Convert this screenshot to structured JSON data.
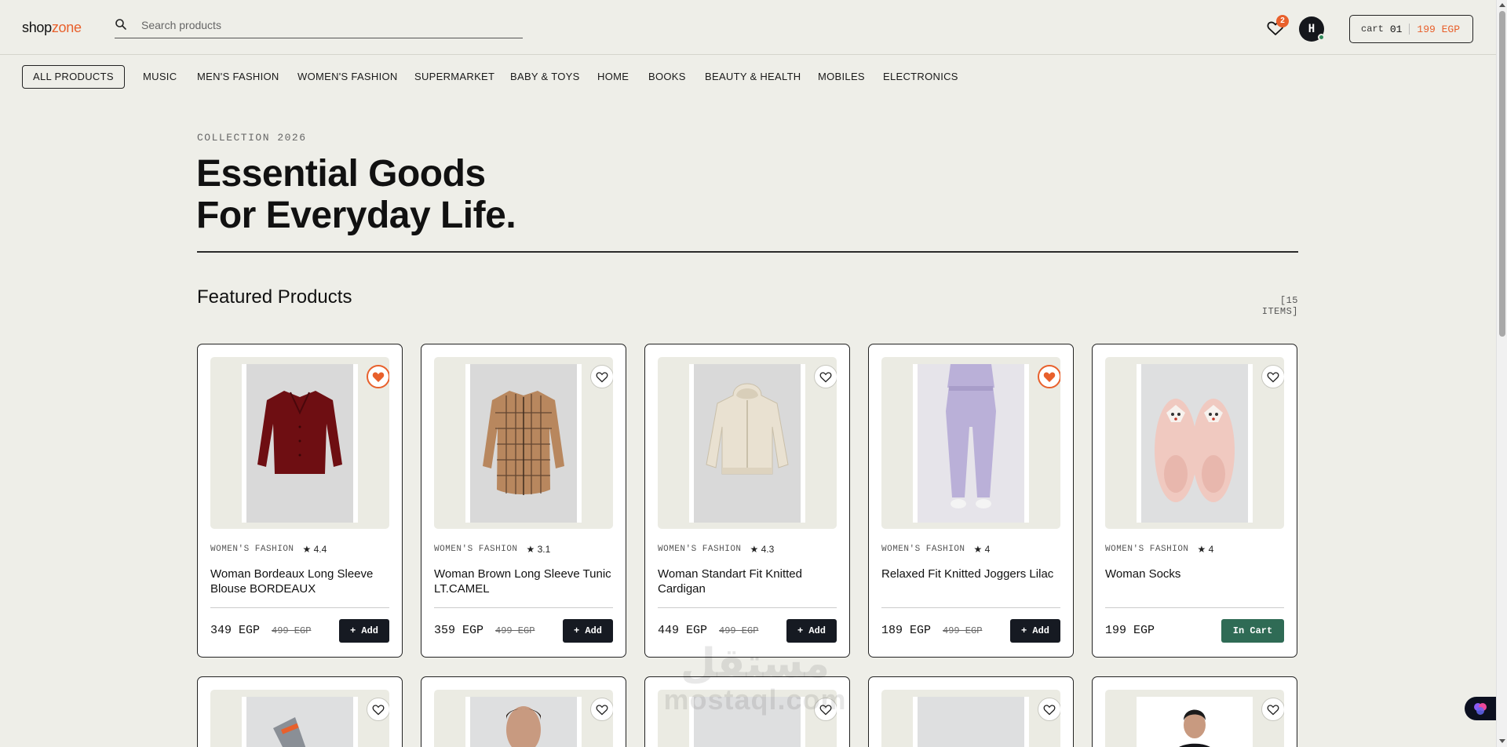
{
  "header": {
    "logo_part1": "shop",
    "logo_part2": "zone",
    "search_placeholder": "Search products",
    "wishlist_count": "2",
    "avatar_initial": "H",
    "cart_label": "cart",
    "cart_count": "01",
    "cart_total": "199 EGP"
  },
  "categories": [
    "ALL PRODUCTS",
    "MUSIC",
    "MEN'S FASHION",
    "WOMEN'S FASHION",
    "SUPERMARKET",
    "BABY & TOYS",
    "HOME",
    "BOOKS",
    "BEAUTY & HEALTH",
    "MOBILES",
    "ELECTRONICS"
  ],
  "active_category": "ALL PRODUCTS",
  "hero": {
    "eyebrow": "COLLECTION 2026",
    "title_line1": "Essential Goods",
    "title_line2": "For Everyday Life."
  },
  "section": {
    "title": "Featured Products",
    "count": "[15 ITEMS]"
  },
  "products": [
    {
      "category": "WOMEN'S FASHION",
      "rating": "★ 4.4",
      "title": "Woman Bordeaux Long Sleeve Blouse BORDEAUX",
      "price": "349 EGP",
      "old_price": "499 EGP",
      "favorited": true,
      "button": "+ Add",
      "garment_icon": "blouse-icon",
      "garment_color": "#6e0e12"
    },
    {
      "category": "WOMEN'S FASHION",
      "rating": "★ 3.1",
      "title": "Woman Brown Long Sleeve Tunic LT.CAMEL",
      "price": "359 EGP",
      "old_price": "499 EGP",
      "favorited": false,
      "button": "+ Add",
      "garment_icon": "plaid-shirt-icon",
      "garment_color": "#b8875e"
    },
    {
      "category": "WOMEN'S FASHION",
      "rating": "★ 4.3",
      "title": "Woman Standart Fit Knitted Cardigan",
      "price": "449 EGP",
      "old_price": "499 EGP",
      "favorited": false,
      "button": "+ Add",
      "garment_icon": "hoodie-icon",
      "garment_color": "#e9e1d1"
    },
    {
      "category": "WOMEN'S FASHION",
      "rating": "★ 4",
      "title": "Relaxed Fit Knitted Joggers Lilac",
      "price": "189 EGP",
      "old_price": "499 EGP",
      "favorited": true,
      "button": "+ Add",
      "garment_icon": "joggers-icon",
      "garment_color": "#bab0d8"
    },
    {
      "category": "WOMEN'S FASHION",
      "rating": "★ 4",
      "title": "Woman Socks",
      "price": "199 EGP",
      "old_price": "",
      "favorited": false,
      "button": "In Cart",
      "garment_icon": "slipper-socks-icon",
      "garment_color": "#f0c9c0"
    }
  ],
  "watermark": {
    "arabic": "مستقل",
    "latin": "mostaql.com"
  },
  "colors": {
    "background": "#eeeee8",
    "accent": "#e8602c",
    "dark": "#161a22",
    "in_cart_green": "#2f6b55"
  }
}
